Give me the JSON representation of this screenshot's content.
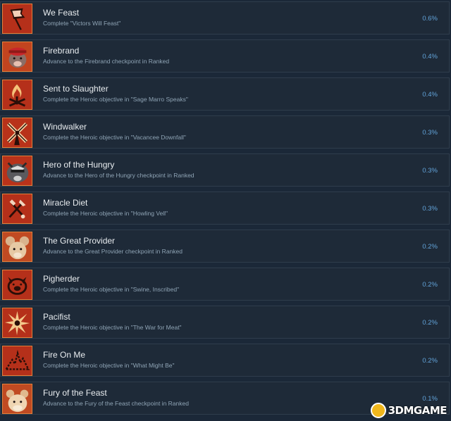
{
  "achievements": [
    {
      "title": "We Feast",
      "desc": "Complete \"Victors Will Feast\"",
      "percent": "0.6%",
      "icon": "banner-flag-icon"
    },
    {
      "title": "Firebrand",
      "desc": "Advance to the Firebrand checkpoint in Ranked",
      "percent": "0.4%",
      "icon": "rat-portrait-icon"
    },
    {
      "title": "Sent to Slaughter",
      "desc": "Complete the Heroic objective in \"Sage Marro Speaks\"",
      "percent": "0.4%",
      "icon": "bonfire-icon"
    },
    {
      "title": "Windwalker",
      "desc": "Complete the Heroic objective in \"Vacancee Downfall\"",
      "percent": "0.3%",
      "icon": "windmill-icon"
    },
    {
      "title": "Hero of the Hungry",
      "desc": "Advance to the Hero of the Hungry checkpoint in Ranked",
      "percent": "0.3%",
      "icon": "badger-portrait-icon"
    },
    {
      "title": "Miracle Diet",
      "desc": "Complete the Heroic objective in \"Howling Vell\"",
      "percent": "0.3%",
      "icon": "tools-icon"
    },
    {
      "title": "The Great Provider",
      "desc": "Advance to the Great Provider checkpoint in Ranked",
      "percent": "0.2%",
      "icon": "mouse-portrait-icon"
    },
    {
      "title": "Pigherder",
      "desc": "Complete the Heroic objective in \"Swine, Inscribed\"",
      "percent": "0.2%",
      "icon": "pig-head-icon"
    },
    {
      "title": "Pacifist",
      "desc": "Complete the Heroic objective in \"The War for Meat\"",
      "percent": "0.2%",
      "icon": "explosion-icon"
    },
    {
      "title": "Fire On Me",
      "desc": "Complete the Heroic objective in \"What Might Be\"",
      "percent": "0.2%",
      "icon": "fire-outline-icon"
    },
    {
      "title": "Fury of the Feast",
      "desc": "Advance to the Fury of the Feast checkpoint in Ranked",
      "percent": "0.1%",
      "icon": "hamster-portrait-icon"
    }
  ],
  "watermark": "3DMGAME",
  "colors": {
    "background": "#1b2838",
    "row": "#1e2a38",
    "percent": "#62a3d9",
    "icon_bg": "#b8321a"
  }
}
